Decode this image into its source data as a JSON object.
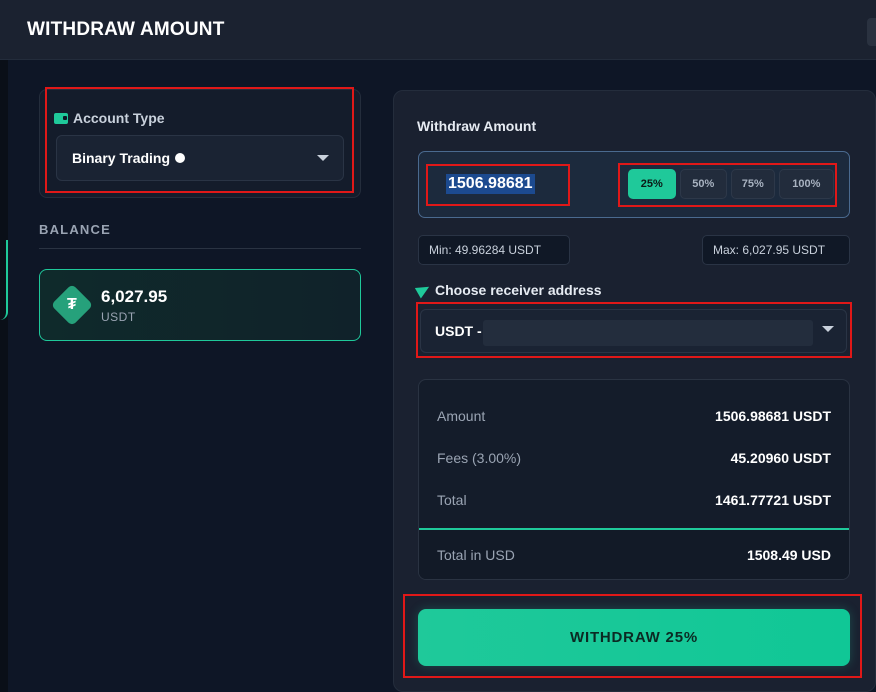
{
  "header": {
    "title": "WITHDRAW AMOUNT"
  },
  "account": {
    "label": "Account Type",
    "selected": "Binary Trading"
  },
  "balance": {
    "label": "BALANCE",
    "value": "6,027.95",
    "unit": "USDT"
  },
  "withdraw": {
    "label": "Withdraw Amount",
    "amount": "1506.98681",
    "percent_options": [
      "25%",
      "50%",
      "75%",
      "100%"
    ],
    "selected_percent": "25%",
    "min": "Min: 49.96284 USDT",
    "max": "Max: 6,027.95 USDT"
  },
  "receiver": {
    "label": "Choose receiver address",
    "prefix": "USDT -"
  },
  "summary": {
    "rows": [
      {
        "key": "Amount",
        "value": "1506.98681 USDT"
      },
      {
        "key": "Fees (3.00%)",
        "value": "45.20960 USDT"
      },
      {
        "key": "Total",
        "value": "1461.77721 USDT"
      }
    ],
    "total_usd_label": "Total in USD",
    "total_usd_value": "1508.49 USD"
  },
  "action": {
    "button_label": "WITHDRAW 25%"
  },
  "colors": {
    "accent": "#1fc99a",
    "highlight": "#e01818"
  }
}
